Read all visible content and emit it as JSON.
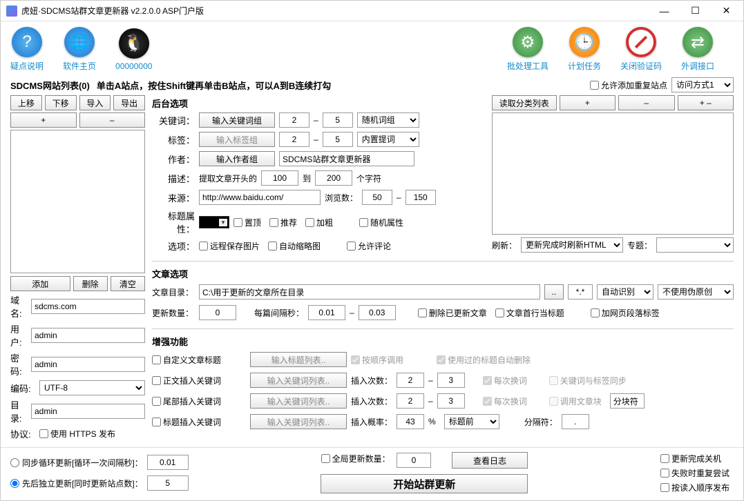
{
  "title": "虎妞·SDCMS站群文章更新器 v2.2.0.0 ASP门户版",
  "toolbar_left": [
    {
      "label": "疑点说明",
      "icon": "question"
    },
    {
      "label": "软件主页",
      "icon": "globe"
    },
    {
      "label": "00000000",
      "icon": "qq"
    }
  ],
  "toolbar_right": [
    {
      "label": "批处理工具",
      "icon": "gear"
    },
    {
      "label": "计划任务",
      "icon": "clock"
    },
    {
      "label": "关闭验证码",
      "icon": "forbid"
    },
    {
      "label": "外调接口",
      "icon": "swap"
    }
  ],
  "subhead": {
    "list_title": "SDCMS网站列表(0)",
    "hint": "单击A站点，按住Shift键再单击B站点，可以A到B连续打勾",
    "allow_dup": "允许添加重复站点",
    "access_mode": "访问方式1"
  },
  "left": {
    "btns1": [
      "上移",
      "下移",
      "导入",
      "导出"
    ],
    "btns2": [
      "+",
      "–"
    ],
    "btns3": {
      "add": "添加",
      "del": "删除",
      "clear": "清空"
    },
    "fields": {
      "domain_lbl": "域名:",
      "domain": "sdcms.com",
      "user_lbl": "用户:",
      "user": "admin",
      "pass_lbl": "密码:",
      "pass": "admin",
      "enc_lbl": "编码:",
      "enc": "UTF-8",
      "dir_lbl": "目录:",
      "dir": "admin",
      "proto_lbl": "协议:",
      "proto_chk": "使用 HTTPS 发布"
    }
  },
  "backend": {
    "title": "后台选项",
    "keyword_lbl": "关键词：",
    "keyword_btn": "输入关键词组",
    "kw_from": "2",
    "kw_to": "5",
    "kw_sel": "随机词组",
    "tag_lbl": "标签：",
    "tag_btn": "输入标签组",
    "tag_from": "2",
    "tag_to": "5",
    "tag_sel": "内置提词",
    "author_lbl": "作者：",
    "author_btn": "输入作者组",
    "author_val": "SDCMS站群文章更新器",
    "desc_lbl": "描述：",
    "desc_pre": "提取文章开头的",
    "desc_from": "100",
    "desc_mid": "到",
    "desc_to": "200",
    "desc_suf": "个字符",
    "source_lbl": "来源：",
    "source_val": "http://www.baidu.com/",
    "views_lbl": "浏览数：",
    "views_from": "50",
    "views_to": "150",
    "title_attr_lbl": "标题属性：",
    "chk_top": "置顶",
    "chk_rec": "推荐",
    "chk_bold": "加粗",
    "chk_rand": "随机属性",
    "opt_lbl": "选项：",
    "chk_remote": "远程保存图片",
    "chk_thumb": "自动缩略图",
    "chk_comment": "允许评论"
  },
  "right": {
    "read_btn": "读取分类列表",
    "plus": "+",
    "minus": "–",
    "plusminus": "+ –",
    "refresh_lbl": "刷新：",
    "refresh_sel": "更新完成时刷新HTML",
    "topic_lbl": "专题："
  },
  "article": {
    "title": "文章选项",
    "dir_lbl": "文章目录：",
    "dir_val": "C:\\用于更新的文章所在目录",
    "dir_browse": "..",
    "filter": "*.*",
    "auto": "自动识别",
    "orig": "不使用伪原创",
    "count_lbl": "更新数量：",
    "count_val": "0",
    "interval_lbl": "每篇间隔秒：",
    "int_from": "0.01",
    "int_to": "0.03",
    "chk_del": "删除已更新文章",
    "chk_firstline": "文章首行当标题",
    "chk_ptag": "加网页段落标签"
  },
  "enhance": {
    "title": "增强功能",
    "chk_custom_title": "自定义文章标题",
    "btn_title_list": "输入标题列表..",
    "chk_order": "按顺序调用",
    "chk_autodel": "使用过的标题自动删除",
    "chk_body_kw": "正文插入关键词",
    "btn_body_kw": "输入关键词列表..",
    "insert_count_lbl": "插入次数：",
    "ic_from": "2",
    "ic_to": "3",
    "chk_newline1": "每次换词",
    "chk_sync": "关键词与标签同步",
    "chk_tail_kw": "尾部插入关键词",
    "btn_tail_kw": "输入关键词列表..",
    "insert_count_lbl2": "插入次数：",
    "tc_from": "2",
    "tc_to": "3",
    "chk_newline2": "每次换词",
    "chk_block": "调用文章块",
    "block_val": "分块符",
    "chk_title_kw": "标题插入关键词",
    "btn_title_kw": "输入关键词列表..",
    "insert_rate_lbl": "插入概率：",
    "rate_val": "43",
    "rate_suf": "%",
    "title_pos": "标题前",
    "sep_lbl": "分隔符：",
    "sep_val": "."
  },
  "bottom": {
    "radio_loop": "同步循环更新[循环一次间隔秒]：",
    "loop_val": "0.01",
    "radio_first": "先后独立更新[同时更新站点数]：",
    "first_val": "5",
    "chk_global": "全局更新数量：",
    "global_val": "0",
    "btn_log": "查看日志",
    "btn_start": "开始站群更新",
    "chk_shutdown": "更新完成关机",
    "chk_retry": "失败时重复尝试",
    "chk_queue": "按读入顺序发布"
  }
}
